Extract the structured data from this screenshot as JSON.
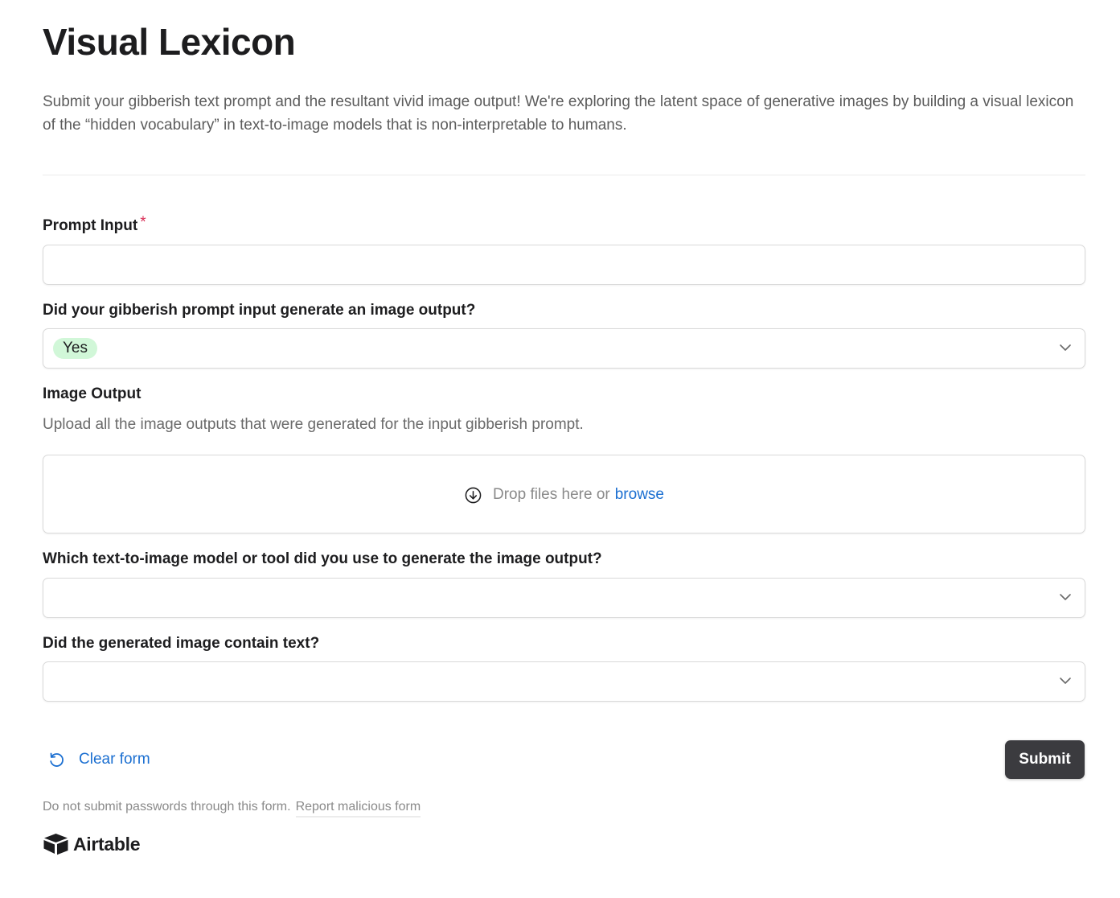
{
  "form": {
    "title": "Visual Lexicon",
    "description": "Submit your gibberish text prompt and the resultant vivid image output! We're exploring the latent space of generative images by building a visual lexicon of the “hidden vocabulary” in text-to-image models that is non-interpretable to humans."
  },
  "fields": {
    "prompt_input": {
      "label": "Prompt Input",
      "required_mark": "*",
      "value": ""
    },
    "generated_image": {
      "label": "Did your gibberish prompt input generate an image output?",
      "selected": "Yes",
      "selected_color": "#d1f7d8"
    },
    "image_output": {
      "label": "Image Output",
      "help": "Upload all the image outputs that were generated for the input gibberish prompt.",
      "drop_text": "Drop files here or",
      "browse_label": "browse"
    },
    "model_tool": {
      "label": "Which text-to-image model or tool did you use to generate the image output?",
      "selected": ""
    },
    "contains_text": {
      "label": "Did the generated image contain text?",
      "selected": ""
    }
  },
  "actions": {
    "clear_label": "Clear form",
    "submit_label": "Submit"
  },
  "footer": {
    "note": "Do not submit passwords through this form.",
    "report_label": "Report malicious form",
    "brand": "Airtable"
  },
  "colors": {
    "link": "#1b6fd1",
    "submit_bg": "#3b3b3f",
    "required": "#d92d55"
  },
  "icons": [
    "chevron-down-icon",
    "download-circle-icon",
    "undo-icon",
    "airtable-logo-icon"
  ]
}
